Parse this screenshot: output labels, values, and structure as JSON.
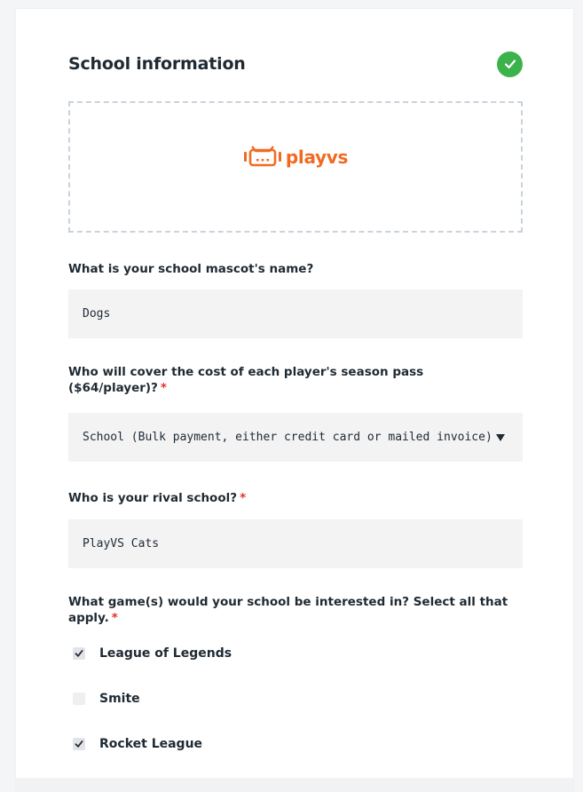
{
  "form": {
    "title": "School information",
    "status_icon": "check-circle-icon",
    "accent_color": "#3bb34a",
    "logo": {
      "text": "playvs",
      "icon": "playvs-logo-icon",
      "color": "#f26a21"
    },
    "mascot": {
      "label": "What is your school mascot's name?",
      "value": "Dogs"
    },
    "cost": {
      "label": "Who will cover the cost of each player's season pass ($64/player)?",
      "required": "*",
      "selected": "School (Bulk payment, either credit card or mailed invoice)"
    },
    "rival": {
      "label": "Who is your rival school?",
      "required": "*",
      "value": "PlayVS Cats"
    },
    "games": {
      "label": "What game(s) would your school be interested in? Select all that apply.",
      "required": "*",
      "options": [
        {
          "label": "League of Legends",
          "checked": true
        },
        {
          "label": "Smite",
          "checked": false
        },
        {
          "label": "Rocket League",
          "checked": true
        }
      ]
    }
  }
}
